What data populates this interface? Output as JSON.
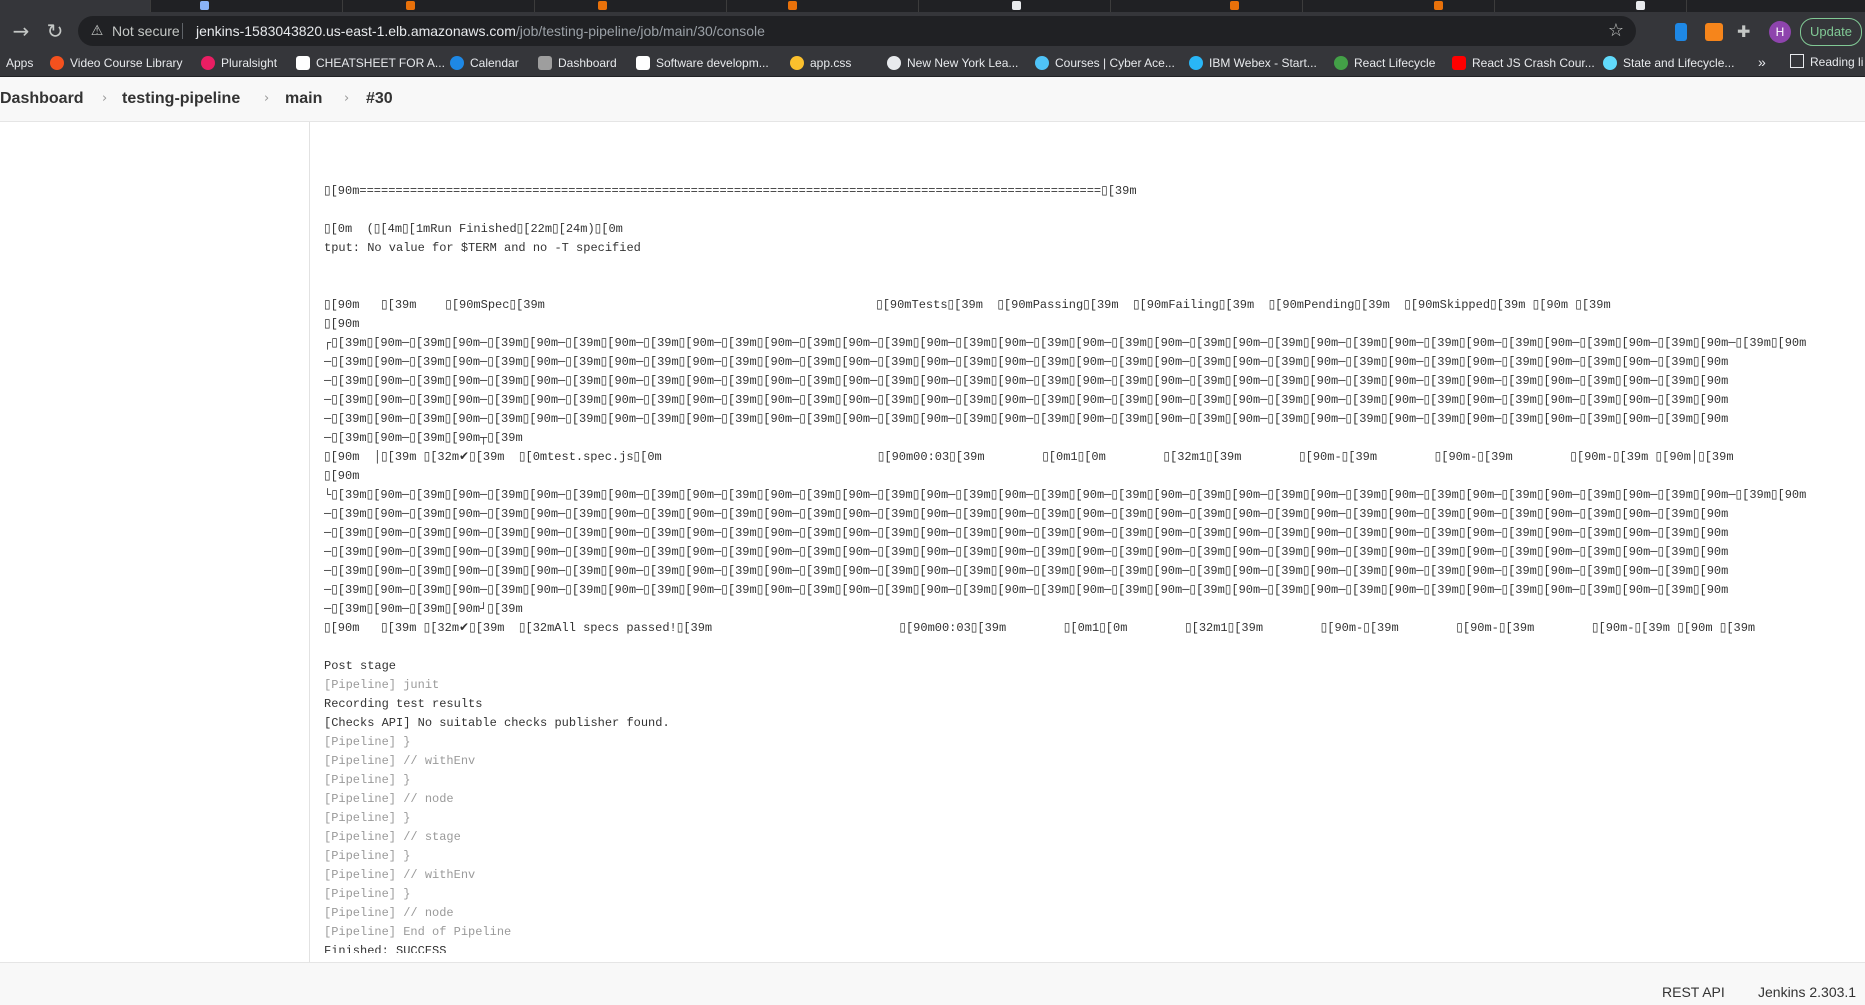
{
  "browser": {
    "address": {
      "security_label": "Not secure",
      "host": "jenkins-1583043820.us-east-1.elb.amazonaws.com",
      "path": "/job/testing-pipeline/job/main/30/console"
    },
    "profile_initial": "H",
    "update_label": "Update",
    "bookmarks": [
      {
        "label": "Apps",
        "icon": "apps-grid-icon",
        "color": "#8ab4f8"
      },
      {
        "label": "Video Course Library",
        "icon": "video-course-icon",
        "color": "#f4511e"
      },
      {
        "label": "Pluralsight",
        "icon": "pluralsight-icon",
        "color": "#e91e63"
      },
      {
        "label": "CHEATSHEET FOR A...",
        "icon": "cheatsheet-icon",
        "color": "#ffffff"
      },
      {
        "label": "Calendar",
        "icon": "calendar-icon",
        "color": "#1e88e5"
      },
      {
        "label": "Dashboard",
        "icon": "dashboard-icon",
        "color": "#9e9e9e"
      },
      {
        "label": "Software developm...",
        "icon": "amazon-icon",
        "color": "#ffffff"
      },
      {
        "label": "app.css",
        "icon": "app-css-icon",
        "color": "#fbc02d"
      },
      {
        "label": "New New York Lea...",
        "icon": "globe-icon",
        "color": "#e8eaed"
      },
      {
        "label": "Courses | Cyber Ace...",
        "icon": "star-badge-icon",
        "color": "#4fc3f7"
      },
      {
        "label": "IBM Webex - Start...",
        "icon": "webex-icon",
        "color": "#29b6f6"
      },
      {
        "label": "React Lifecycle",
        "icon": "react-lifecycle-icon",
        "color": "#43a047"
      },
      {
        "label": "React JS Crash Cour...",
        "icon": "youtube-icon",
        "color": "#ff0000"
      },
      {
        "label": "State and Lifecycle...",
        "icon": "react-icon",
        "color": "#61dafb"
      }
    ],
    "more_label": "»",
    "reading_list_label": "Reading li"
  },
  "breadcrumbs": [
    "Dashboard",
    "testing-pipeline",
    "main",
    "#30"
  ],
  "console": {
    "lines": [
      {
        "text": "",
        "dim": false
      },
      {
        "text": "\u0000[90m=======================================================================================================\u0000[39m",
        "dim": false
      },
      {
        "text": "",
        "dim": false
      },
      {
        "text": "\u0000[0m  (\u0000[4m\u0000[1mRun Finished\u0000[22m\u0000[24m)\u0000[0m",
        "dim": false
      },
      {
        "text": "tput: No value for $TERM and no -T specified",
        "dim": false
      },
      {
        "text": "",
        "dim": false
      },
      {
        "text": "",
        "dim": false
      },
      {
        "text": "\u0000[90m   \u0000[39m    \u0000[90mSpec\u0000[39m                                              \u0000[90mTests\u0000[39m  \u0000[90mPassing\u0000[39m  \u0000[90mFailing\u0000[39m  \u0000[90mPending\u0000[39m  \u0000[90mSkipped\u0000[39m \u0000[90m \u0000[39m",
        "dim": false
      },
      {
        "text": "\u0000[90m",
        "dim": false
      },
      {
        "text": "┌\u0000[39m\u0000[90m─\u0000[39m\u0000[90m─\u0000[39m\u0000[90m─\u0000[39m\u0000[90m─\u0000[39m\u0000[90m─\u0000[39m\u0000[90m─\u0000[39m\u0000[90m─\u0000[39m\u0000[90m─\u0000[39m\u0000[90m─\u0000[39m\u0000[90m─\u0000[39m\u0000[90m─\u0000[39m\u0000[90m─\u0000[39m\u0000[90m─\u0000[39m\u0000[90m─\u0000[39m\u0000[90m─\u0000[39m\u0000[90m─\u0000[39m\u0000[90m─\u0000[39m\u0000[90m─\u0000[39m\u0000[90m",
        "dim": false
      },
      {
        "text": "─\u0000[39m\u0000[90m─\u0000[39m\u0000[90m─\u0000[39m\u0000[90m─\u0000[39m\u0000[90m─\u0000[39m\u0000[90m─\u0000[39m\u0000[90m─\u0000[39m\u0000[90m─\u0000[39m\u0000[90m─\u0000[39m\u0000[90m─\u0000[39m\u0000[90m─\u0000[39m\u0000[90m─\u0000[39m\u0000[90m─\u0000[39m\u0000[90m─\u0000[39m\u0000[90m─\u0000[39m\u0000[90m─\u0000[39m\u0000[90m─\u0000[39m\u0000[90m─\u0000[39m\u0000[90m",
        "dim": false
      },
      {
        "text": "─\u0000[39m\u0000[90m─\u0000[39m\u0000[90m─\u0000[39m\u0000[90m─\u0000[39m\u0000[90m─\u0000[39m\u0000[90m─\u0000[39m\u0000[90m─\u0000[39m\u0000[90m─\u0000[39m\u0000[90m─\u0000[39m\u0000[90m─\u0000[39m\u0000[90m─\u0000[39m\u0000[90m─\u0000[39m\u0000[90m─\u0000[39m\u0000[90m─\u0000[39m\u0000[90m─\u0000[39m\u0000[90m─\u0000[39m\u0000[90m─\u0000[39m\u0000[90m─\u0000[39m\u0000[90m",
        "dim": false
      },
      {
        "text": "─\u0000[39m\u0000[90m─\u0000[39m\u0000[90m─\u0000[39m\u0000[90m─\u0000[39m\u0000[90m─\u0000[39m\u0000[90m─\u0000[39m\u0000[90m─\u0000[39m\u0000[90m─\u0000[39m\u0000[90m─\u0000[39m\u0000[90m─\u0000[39m\u0000[90m─\u0000[39m\u0000[90m─\u0000[39m\u0000[90m─\u0000[39m\u0000[90m─\u0000[39m\u0000[90m─\u0000[39m\u0000[90m─\u0000[39m\u0000[90m─\u0000[39m\u0000[90m─\u0000[39m\u0000[90m",
        "dim": false
      },
      {
        "text": "─\u0000[39m\u0000[90m─\u0000[39m\u0000[90m─\u0000[39m\u0000[90m─\u0000[39m\u0000[90m─\u0000[39m\u0000[90m─\u0000[39m\u0000[90m─\u0000[39m\u0000[90m─\u0000[39m\u0000[90m─\u0000[39m\u0000[90m─\u0000[39m\u0000[90m─\u0000[39m\u0000[90m─\u0000[39m\u0000[90m─\u0000[39m\u0000[90m─\u0000[39m\u0000[90m─\u0000[39m\u0000[90m─\u0000[39m\u0000[90m─\u0000[39m\u0000[90m─\u0000[39m\u0000[90m",
        "dim": false
      },
      {
        "text": "─\u0000[39m\u0000[90m─\u0000[39m\u0000[90m┬\u0000[39m",
        "dim": false
      },
      {
        "text": "\u0000[90m  │\u0000[39m \u0000[32m✔\u0000[39m  \u0000[0mtest.spec.js\u0000[0m                              \u0000[90m00:03\u0000[39m        \u0000[0m1\u0000[0m        \u0000[32m1\u0000[39m        \u0000[90m-\u0000[39m        \u0000[90m-\u0000[39m        \u0000[90m-\u0000[39m \u0000[90m│\u0000[39m",
        "dim": false
      },
      {
        "text": "\u0000[90m",
        "dim": false
      },
      {
        "text": "└\u0000[39m\u0000[90m─\u0000[39m\u0000[90m─\u0000[39m\u0000[90m─\u0000[39m\u0000[90m─\u0000[39m\u0000[90m─\u0000[39m\u0000[90m─\u0000[39m\u0000[90m─\u0000[39m\u0000[90m─\u0000[39m\u0000[90m─\u0000[39m\u0000[90m─\u0000[39m\u0000[90m─\u0000[39m\u0000[90m─\u0000[39m\u0000[90m─\u0000[39m\u0000[90m─\u0000[39m\u0000[90m─\u0000[39m\u0000[90m─\u0000[39m\u0000[90m─\u0000[39m\u0000[90m─\u0000[39m\u0000[90m",
        "dim": false
      },
      {
        "text": "─\u0000[39m\u0000[90m─\u0000[39m\u0000[90m─\u0000[39m\u0000[90m─\u0000[39m\u0000[90m─\u0000[39m\u0000[90m─\u0000[39m\u0000[90m─\u0000[39m\u0000[90m─\u0000[39m\u0000[90m─\u0000[39m\u0000[90m─\u0000[39m\u0000[90m─\u0000[39m\u0000[90m─\u0000[39m\u0000[90m─\u0000[39m\u0000[90m─\u0000[39m\u0000[90m─\u0000[39m\u0000[90m─\u0000[39m\u0000[90m─\u0000[39m\u0000[90m─\u0000[39m\u0000[90m",
        "dim": false
      },
      {
        "text": "─\u0000[39m\u0000[90m─\u0000[39m\u0000[90m─\u0000[39m\u0000[90m─\u0000[39m\u0000[90m─\u0000[39m\u0000[90m─\u0000[39m\u0000[90m─\u0000[39m\u0000[90m─\u0000[39m\u0000[90m─\u0000[39m\u0000[90m─\u0000[39m\u0000[90m─\u0000[39m\u0000[90m─\u0000[39m\u0000[90m─\u0000[39m\u0000[90m─\u0000[39m\u0000[90m─\u0000[39m\u0000[90m─\u0000[39m\u0000[90m─\u0000[39m\u0000[90m─\u0000[39m\u0000[90m",
        "dim": false
      },
      {
        "text": "─\u0000[39m\u0000[90m─\u0000[39m\u0000[90m─\u0000[39m\u0000[90m─\u0000[39m\u0000[90m─\u0000[39m\u0000[90m─\u0000[39m\u0000[90m─\u0000[39m\u0000[90m─\u0000[39m\u0000[90m─\u0000[39m\u0000[90m─\u0000[39m\u0000[90m─\u0000[39m\u0000[90m─\u0000[39m\u0000[90m─\u0000[39m\u0000[90m─\u0000[39m\u0000[90m─\u0000[39m\u0000[90m─\u0000[39m\u0000[90m─\u0000[39m\u0000[90m─\u0000[39m\u0000[90m",
        "dim": false
      },
      {
        "text": "─\u0000[39m\u0000[90m─\u0000[39m\u0000[90m─\u0000[39m\u0000[90m─\u0000[39m\u0000[90m─\u0000[39m\u0000[90m─\u0000[39m\u0000[90m─\u0000[39m\u0000[90m─\u0000[39m\u0000[90m─\u0000[39m\u0000[90m─\u0000[39m\u0000[90m─\u0000[39m\u0000[90m─\u0000[39m\u0000[90m─\u0000[39m\u0000[90m─\u0000[39m\u0000[90m─\u0000[39m\u0000[90m─\u0000[39m\u0000[90m─\u0000[39m\u0000[90m─\u0000[39m\u0000[90m",
        "dim": false
      },
      {
        "text": "─\u0000[39m\u0000[90m─\u0000[39m\u0000[90m─\u0000[39m\u0000[90m─\u0000[39m\u0000[90m─\u0000[39m\u0000[90m─\u0000[39m\u0000[90m─\u0000[39m\u0000[90m─\u0000[39m\u0000[90m─\u0000[39m\u0000[90m─\u0000[39m\u0000[90m─\u0000[39m\u0000[90m─\u0000[39m\u0000[90m─\u0000[39m\u0000[90m─\u0000[39m\u0000[90m─\u0000[39m\u0000[90m─\u0000[39m\u0000[90m─\u0000[39m\u0000[90m─\u0000[39m\u0000[90m",
        "dim": false
      },
      {
        "text": "─\u0000[39m\u0000[90m─\u0000[39m\u0000[90m┘\u0000[39m",
        "dim": false
      },
      {
        "text": "\u0000[90m   \u0000[39m \u0000[32m✔\u0000[39m  \u0000[32mAll specs passed!\u0000[39m                          \u0000[90m00:03\u0000[39m        \u0000[0m1\u0000[0m        \u0000[32m1\u0000[39m        \u0000[90m-\u0000[39m        \u0000[90m-\u0000[39m        \u0000[90m-\u0000[39m \u0000[90m \u0000[39m",
        "dim": false
      },
      {
        "text": "",
        "dim": false
      },
      {
        "text": "Post stage",
        "dim": false
      },
      {
        "text": "[Pipeline] junit",
        "dim": true
      },
      {
        "text": "Recording test results",
        "dim": false
      },
      {
        "text": "[Checks API] No suitable checks publisher found.",
        "dim": false
      },
      {
        "text": "[Pipeline] }",
        "dim": true
      },
      {
        "text": "[Pipeline] // withEnv",
        "dim": true
      },
      {
        "text": "[Pipeline] }",
        "dim": true
      },
      {
        "text": "[Pipeline] // node",
        "dim": true
      },
      {
        "text": "[Pipeline] }",
        "dim": true
      },
      {
        "text": "[Pipeline] // stage",
        "dim": true
      },
      {
        "text": "[Pipeline] }",
        "dim": true
      },
      {
        "text": "[Pipeline] // withEnv",
        "dim": true
      },
      {
        "text": "[Pipeline] }",
        "dim": true
      },
      {
        "text": "[Pipeline] // node",
        "dim": true
      },
      {
        "text": "[Pipeline] End of Pipeline",
        "dim": true
      },
      {
        "text": "Finished: SUCCESS",
        "dim": false
      }
    ]
  },
  "footer": {
    "rest_api_label": "REST API",
    "version_label": "Jenkins 2.303.1"
  }
}
